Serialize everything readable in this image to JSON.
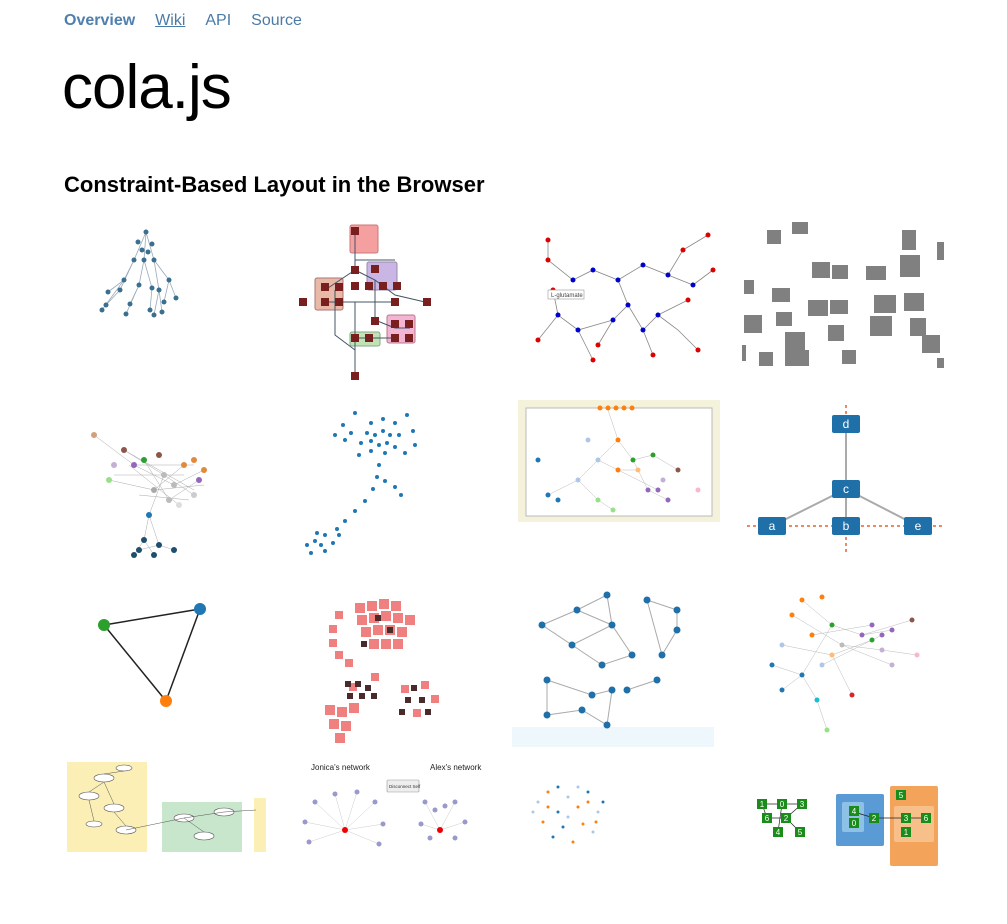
{
  "nav": {
    "overview": "Overview",
    "wiki": "Wiki",
    "api": "API",
    "source": "Source"
  },
  "header": {
    "title": "cola.js",
    "subtitle": "Constraint-Based Layout in the Browser"
  },
  "gallery": {
    "tile_6_labels": [
      "d",
      "c",
      "a",
      "b",
      "e"
    ],
    "tile_10_labels": {
      "left_network": "Jonica's network",
      "right_network": "Alex's network",
      "button": "Disconnect Self"
    },
    "tile_2_label": "L-glutamate",
    "tile_15_labels": [
      "1",
      "0",
      "3",
      "6",
      "2",
      "4",
      "5",
      "4",
      "5",
      "2",
      "0",
      "3",
      "6",
      "1"
    ]
  },
  "colors": {
    "nav_link": "#4a7aa7",
    "node_blue": "#1f77b4",
    "node_orange": "#ff7f0e",
    "node_green": "#2ca02c",
    "grey_box": "#808080",
    "pink_tile": "#f08080"
  }
}
